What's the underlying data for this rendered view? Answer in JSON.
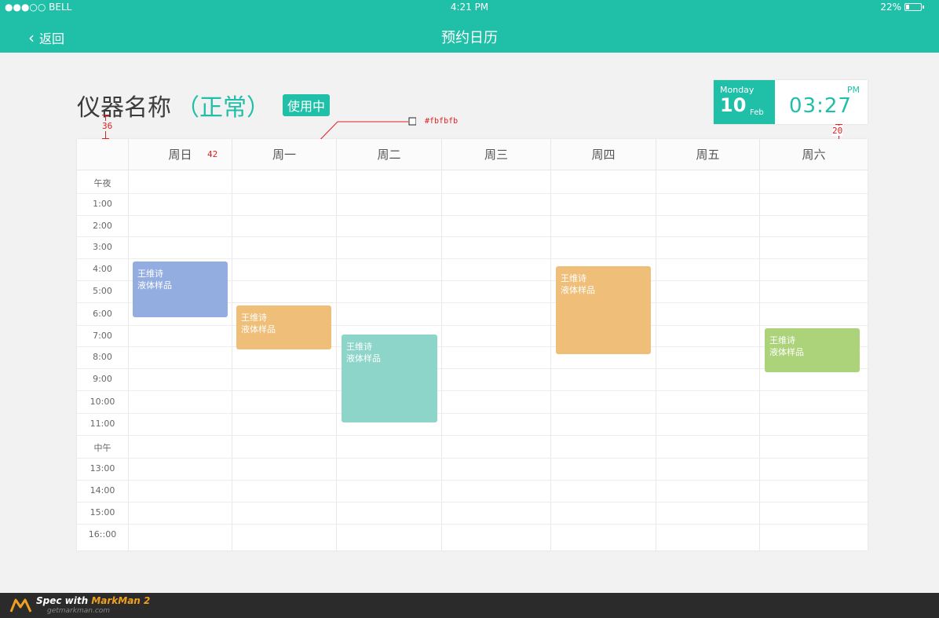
{
  "status_bar": {
    "carrier": "●●●○○ BELL",
    "time": "4:21 PM",
    "battery": "22%"
  },
  "nav": {
    "back_label": "返回",
    "title": "预约日历"
  },
  "instrument": {
    "name": "仪器名称",
    "status": "（正常）",
    "badge": "使用中"
  },
  "clock": {
    "weekday": "Monday",
    "day": "10",
    "month": "Feb",
    "ampm": "PM",
    "time": "03:27"
  },
  "spec_notes": {
    "title_gap": "36",
    "header_height": "42",
    "card_gap": "20",
    "header_color": "#fbfbfb"
  },
  "calendar": {
    "days": [
      "周日",
      "周一",
      "周二",
      "周三",
      "周四",
      "周五",
      "周六"
    ],
    "hours": [
      "午夜",
      "1:00",
      "2:00",
      "3:00",
      "4:00",
      "5:00",
      "6:00",
      "7:00",
      "8:00",
      "9:00",
      "10:00",
      "11:00",
      "中午",
      "13:00",
      "14:00",
      "15:00",
      "16::00"
    ],
    "events": [
      {
        "user": "王维诗",
        "sample": "液体样品",
        "color": "#93ade0"
      },
      {
        "user": "王维诗",
        "sample": "液体样品",
        "color": "#efbe78"
      },
      {
        "user": "王维诗",
        "sample": "液体样品",
        "color": "#8dd4c9"
      },
      {
        "user": "王维诗",
        "sample": "液体样品",
        "color": "#efbe78"
      },
      {
        "user": "王维诗",
        "sample": "液体样品",
        "color": "#acd37a"
      }
    ]
  },
  "footer": {
    "spec_prefix": "Spec with ",
    "brand": "MarkMan 2",
    "url": "getmarkman.com"
  },
  "colors": {
    "accent": "#20bfa8",
    "annotation": "#e02020"
  }
}
